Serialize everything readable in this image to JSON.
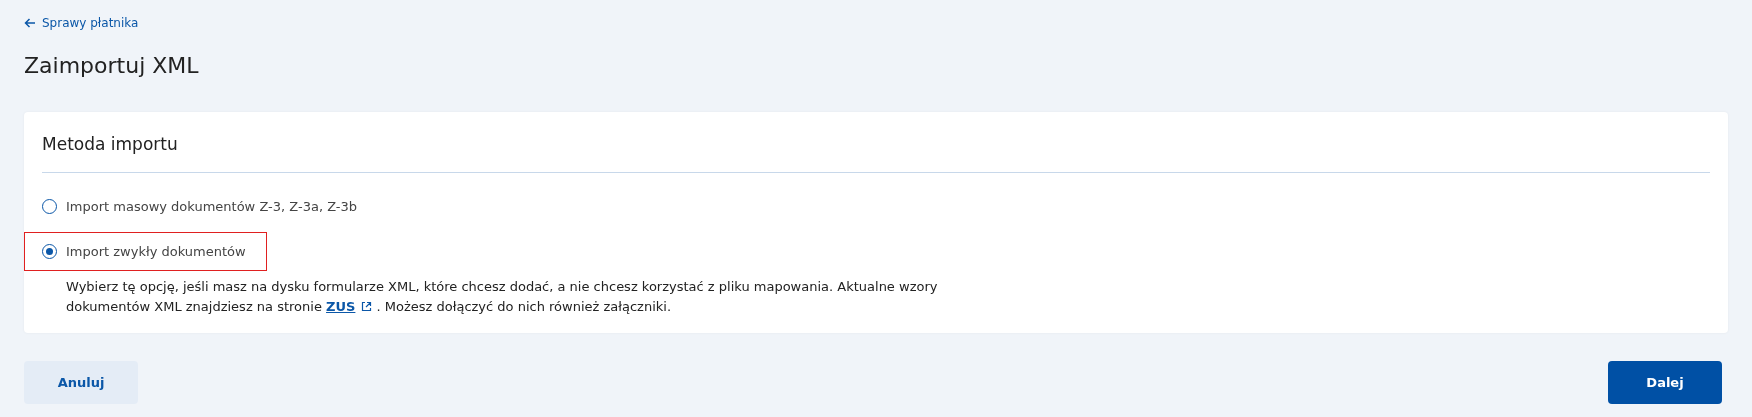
{
  "breadcrumb": {
    "label": "Sprawy płatnika"
  },
  "title": "Zaimportuj XML",
  "card": {
    "heading": "Metoda importu",
    "options": [
      {
        "label": "Import masowy dokumentów Z-3, Z-3a, Z-3b",
        "selected": false,
        "highlighted": false
      },
      {
        "label": "Import zwykły dokumentów",
        "selected": true,
        "highlighted": true
      }
    ],
    "description": {
      "before": "Wybierz tę opcję, jeśli masz na dysku formularze XML, które chcesz dodać, a nie chcesz korzystać z pliku mapowania. Aktualne wzory dokumentów XML znajdziesz na stronie",
      "link": "ZUS",
      "after": ". Możesz dołączyć do nich również załączniki."
    }
  },
  "buttons": [
    {
      "label": "Anuluj",
      "kind": "secondary"
    },
    {
      "label": "Dalej",
      "kind": "primary"
    }
  ]
}
